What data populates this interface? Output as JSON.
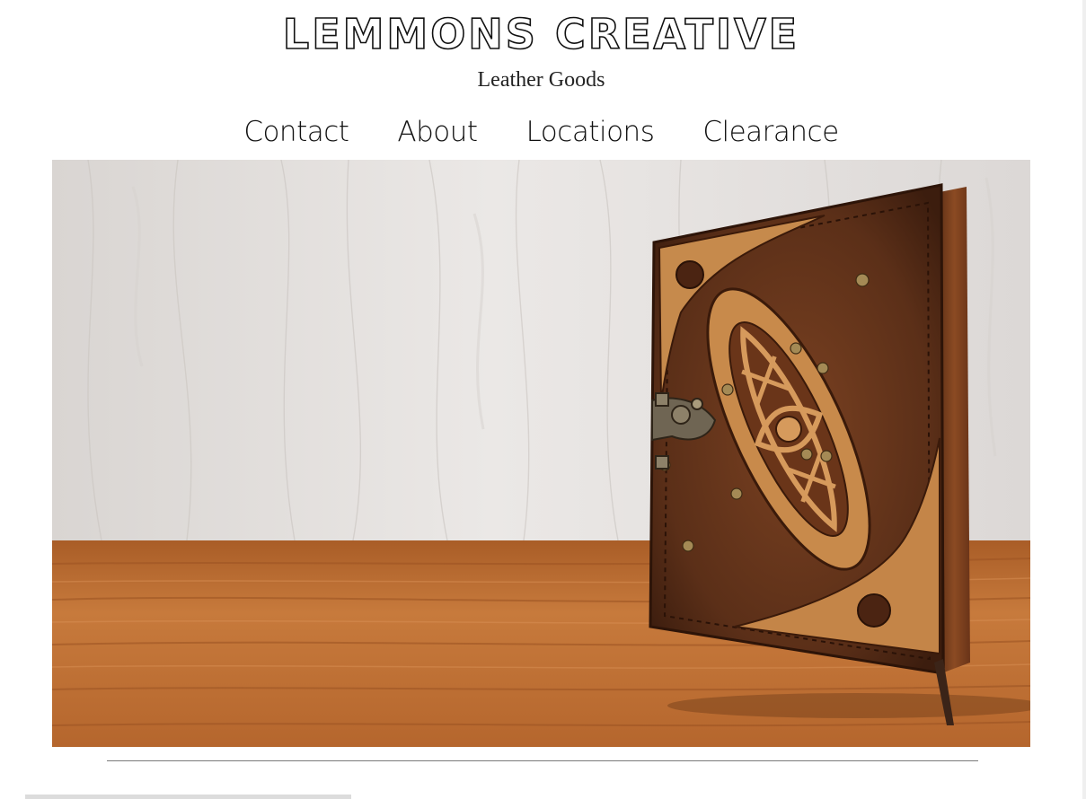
{
  "header": {
    "brand_title": "Lemmons Creative",
    "brand_subtitle": "Leather Goods"
  },
  "nav": {
    "items": [
      {
        "label": "Contact"
      },
      {
        "label": "About"
      },
      {
        "label": "Locations"
      },
      {
        "label": "Clearance"
      }
    ]
  },
  "hero": {
    "image": "leather-journal-photo"
  },
  "colors": {
    "wall": "#e2dfdc",
    "table": "#b0622a",
    "leather_dark": "#5b2f18",
    "leather_light": "#c88a4b",
    "text": "#111111"
  }
}
